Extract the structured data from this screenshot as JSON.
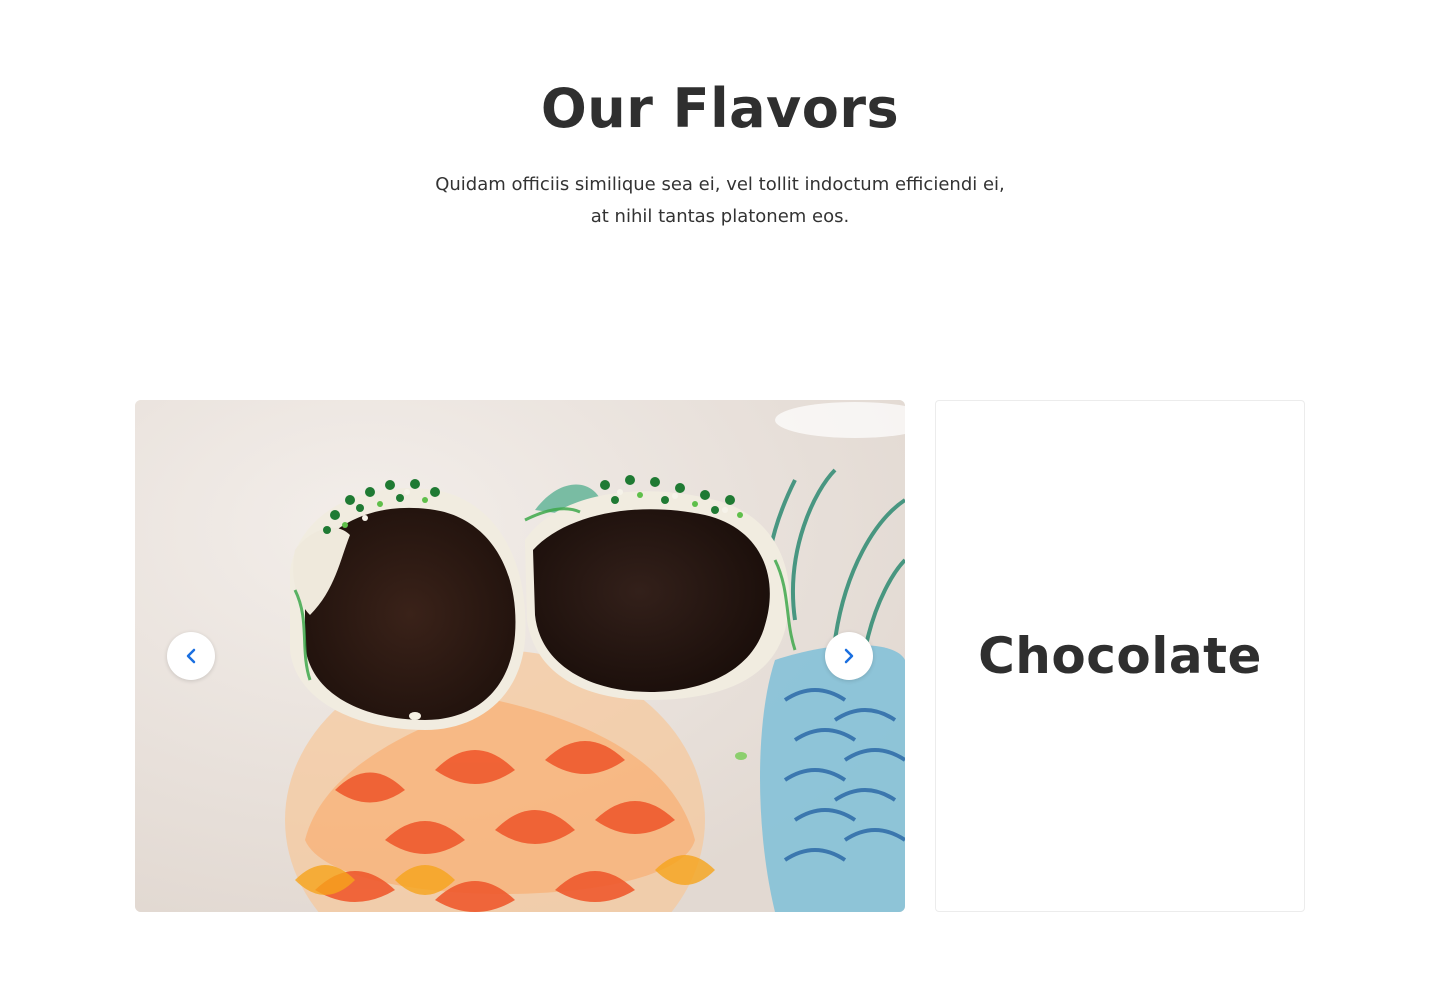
{
  "header": {
    "title": "Our Flavors",
    "subtitle": "Quidam officiis similique sea ei, vel tollit indoctum efficiendi ei, at nihil tantas platonem eos."
  },
  "carousel": {
    "image_alt": "cake ball cut in half on a decorated plate",
    "prev_icon": "chevron-left-icon",
    "next_icon": "chevron-right-icon",
    "accent_color": "#1a6fe0"
  },
  "flavor_card": {
    "name": "Chocolate"
  }
}
